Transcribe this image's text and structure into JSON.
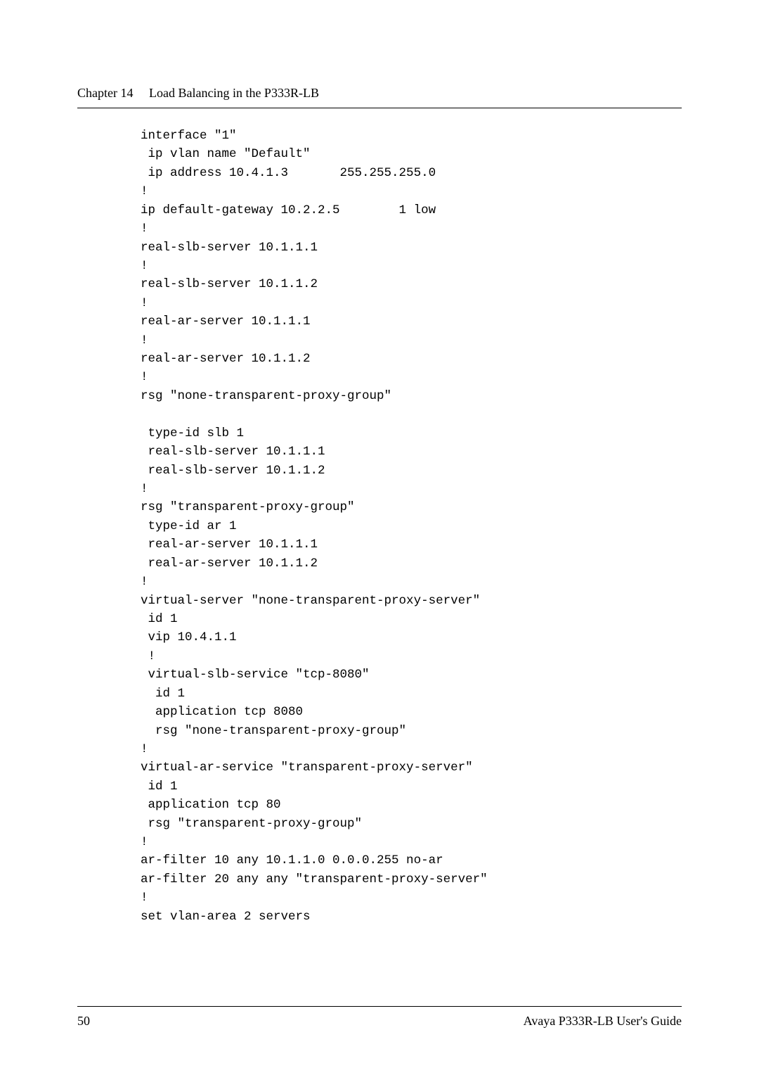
{
  "header": {
    "chapter_label": "Chapter 14",
    "chapter_title": "Load Balancing in the P333R-LB"
  },
  "code_lines": [
    "interface \"1\"",
    " ip vlan name \"Default\"",
    " ip address 10.4.1.3       255.255.255.0",
    "!",
    "ip default-gateway 10.2.2.5        1 low",
    "!",
    "real-slb-server 10.1.1.1",
    "!",
    "real-slb-server 10.1.1.2",
    "!",
    "real-ar-server 10.1.1.1",
    "!",
    "real-ar-server 10.1.1.2",
    "!",
    "rsg \"none-transparent-proxy-group\"",
    "",
    " type-id slb 1",
    " real-slb-server 10.1.1.1",
    " real-slb-server 10.1.1.2",
    "!",
    "rsg \"transparent-proxy-group\"",
    " type-id ar 1",
    " real-ar-server 10.1.1.1",
    " real-ar-server 10.1.1.2",
    "!",
    "virtual-server \"none-transparent-proxy-server\"",
    " id 1",
    " vip 10.4.1.1",
    " !",
    " virtual-slb-service \"tcp-8080\"",
    "  id 1",
    "  application tcp 8080",
    "  rsg \"none-transparent-proxy-group\"",
    "!",
    "virtual-ar-service \"transparent-proxy-server\"",
    " id 1",
    " application tcp 80",
    " rsg \"transparent-proxy-group\"",
    "!",
    "ar-filter 10 any 10.1.1.0 0.0.0.255 no-ar",
    "ar-filter 20 any any \"transparent-proxy-server\"",
    "!",
    "set vlan-area 2 servers"
  ],
  "footer": {
    "page_number": "50",
    "guide_name": "Avaya P333R-LB User's Guide"
  }
}
